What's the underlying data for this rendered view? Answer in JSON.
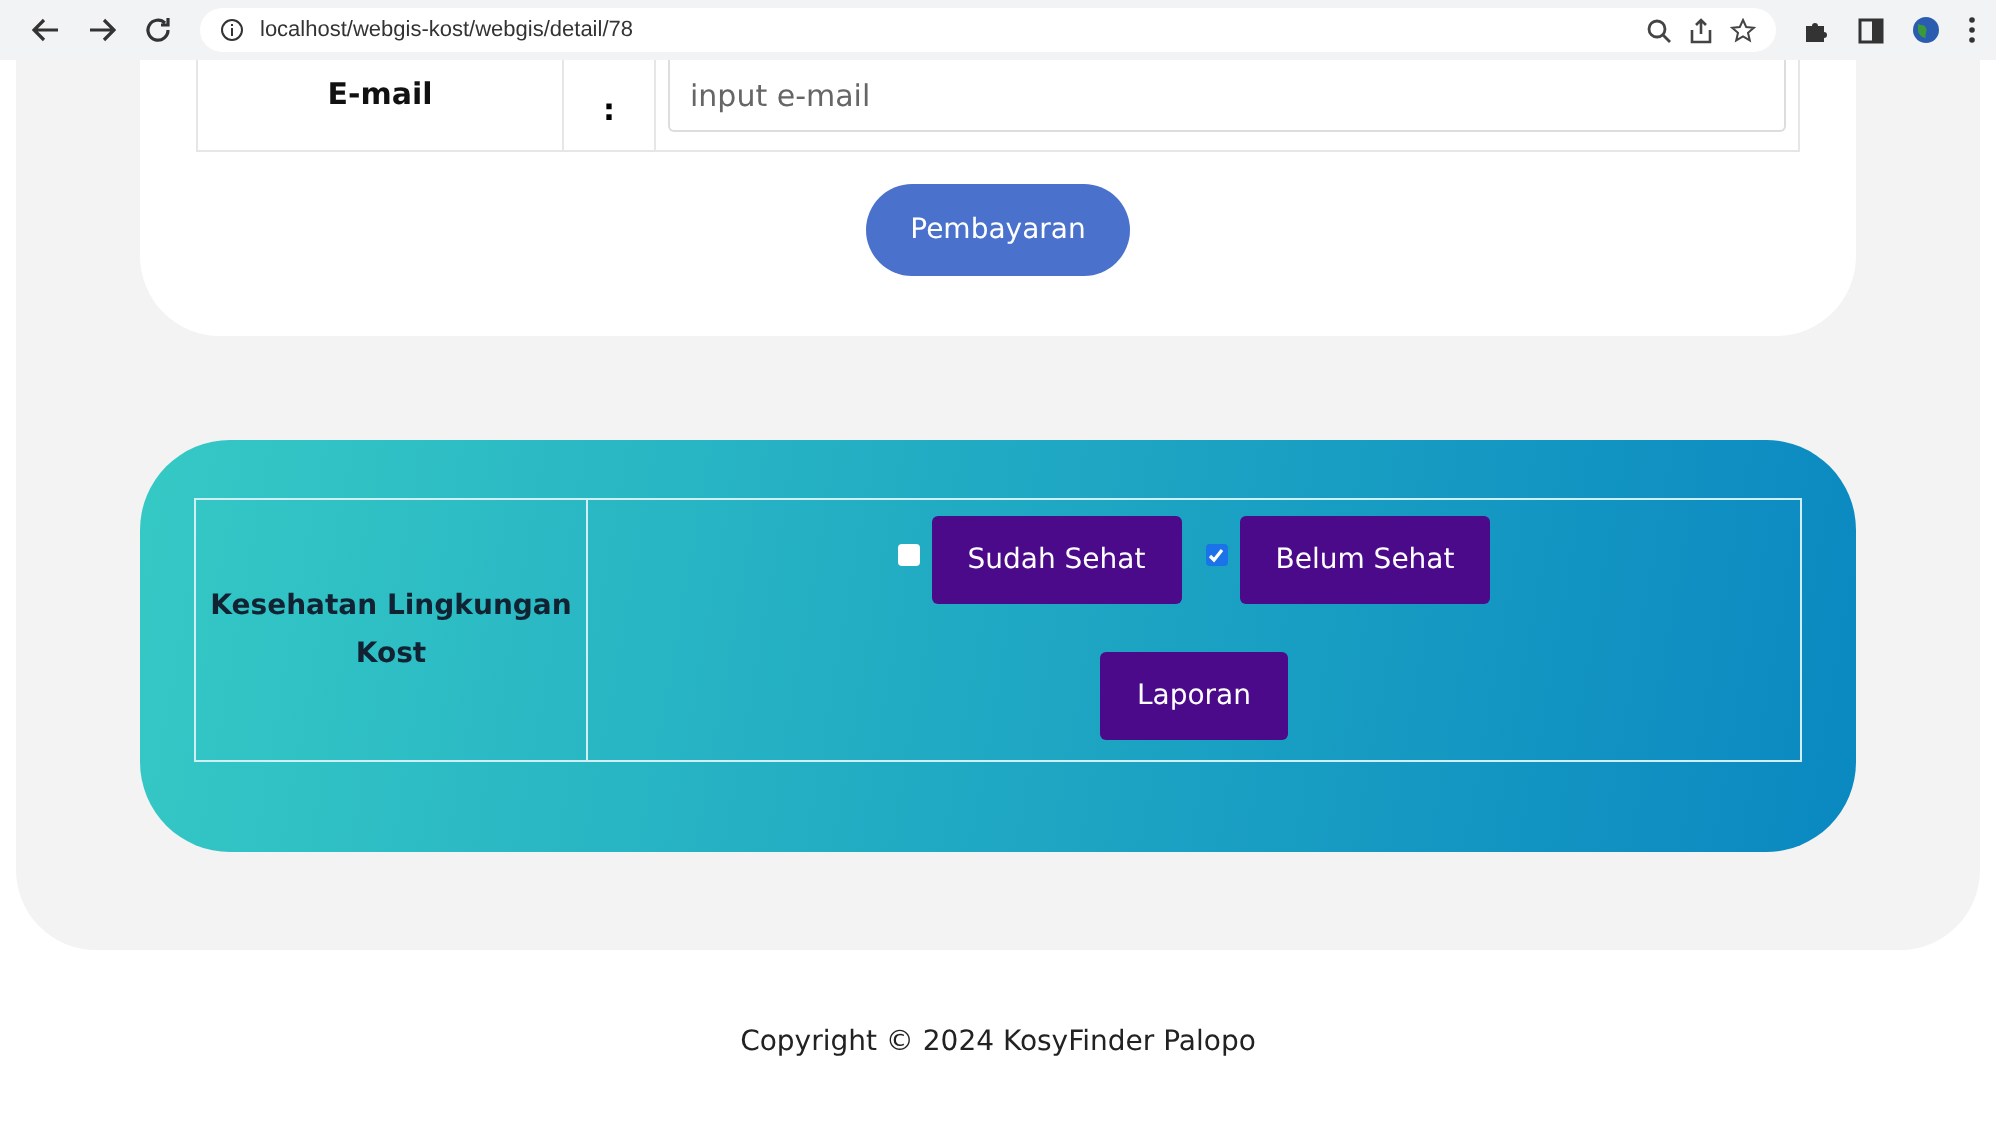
{
  "browser": {
    "url": "localhost/webgis-kost/webgis/detail/78"
  },
  "form": {
    "rows": [
      {
        "label": "E-mail",
        "separator": ":",
        "placeholder": "input e-mail"
      }
    ],
    "submit": "Pembayaran"
  },
  "health": {
    "label": "Kesehatan Lingkungan Kost",
    "options": [
      {
        "label": "Sudah Sehat",
        "checked": false
      },
      {
        "label": "Belum Sehat",
        "checked": true
      }
    ],
    "report": "Laporan"
  },
  "footer": {
    "copyright": "Copyright © 2024 KosyFinder Palopo"
  }
}
